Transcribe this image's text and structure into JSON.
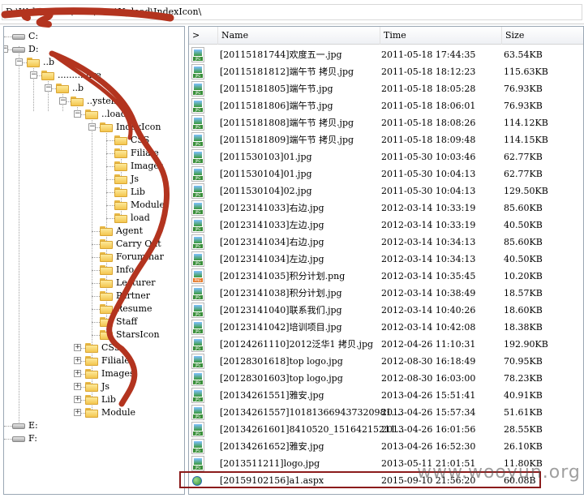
{
  "path_bar": {
    "value": "D:\\Web\\..........\\Web\\.......\\Upload\\IndexIcon\\"
  },
  "tree": {
    "nodes": [
      {
        "label": "C:",
        "kind": "drive"
      },
      {
        "label": "D:",
        "kind": "drive"
      },
      {
        "label": "..b",
        "kind": "folder"
      },
      {
        "label": "..........ure",
        "kind": "folder"
      },
      {
        "label": "..b",
        "kind": "folder"
      },
      {
        "label": "..ystem",
        "kind": "folder"
      },
      {
        "label": "..load",
        "kind": "folder"
      },
      {
        "label": "IndexIcon",
        "kind": "folder"
      },
      {
        "label": "CSS",
        "kind": "folder"
      },
      {
        "label": "Filiale",
        "kind": "folder"
      },
      {
        "label": "Images",
        "kind": "folder"
      },
      {
        "label": "Js",
        "kind": "folder"
      },
      {
        "label": "Lib",
        "kind": "folder"
      },
      {
        "label": "Module",
        "kind": "folder"
      },
      {
        "label": "load",
        "kind": "folder"
      },
      {
        "label": "Agent",
        "kind": "folder"
      },
      {
        "label": "Carry Out",
        "kind": "folder"
      },
      {
        "label": "Foruminar",
        "kind": "folder"
      },
      {
        "label": "Info",
        "kind": "folder"
      },
      {
        "label": "Lecturer",
        "kind": "folder"
      },
      {
        "label": "Partner",
        "kind": "folder"
      },
      {
        "label": "Resume",
        "kind": "folder"
      },
      {
        "label": "Staff",
        "kind": "folder"
      },
      {
        "label": "StarsIcon",
        "kind": "folder"
      },
      {
        "label": "CSS",
        "kind": "folder"
      },
      {
        "label": "Filiale",
        "kind": "folder"
      },
      {
        "label": "Images",
        "kind": "folder"
      },
      {
        "label": "Js",
        "kind": "folder"
      },
      {
        "label": "Lib",
        "kind": "folder"
      },
      {
        "label": "Module",
        "kind": "folder"
      },
      {
        "label": "E:",
        "kind": "drive"
      },
      {
        "label": "F:",
        "kind": "drive"
      }
    ]
  },
  "file_list": {
    "headers": {
      "toggle": ">",
      "name": "Name",
      "time": "Time",
      "size": "Size"
    },
    "rows": [
      {
        "name": "[20115181744]欢度五一.jpg",
        "time": "2011-05-18 17:44:35",
        "size": "63.54KB",
        "type": "jpg"
      },
      {
        "name": "[20115181812]端午节 拷贝.jpg",
        "time": "2011-05-18 18:12:23",
        "size": "115.63KB",
        "type": "jpg"
      },
      {
        "name": "[20115181805]端午节.jpg",
        "time": "2011-05-18 18:05:28",
        "size": "76.93KB",
        "type": "jpg"
      },
      {
        "name": "[20115181806]端午节.jpg",
        "time": "2011-05-18 18:06:01",
        "size": "76.93KB",
        "type": "jpg"
      },
      {
        "name": "[20115181808]端午节 拷贝.jpg",
        "time": "2011-05-18 18:08:26",
        "size": "114.12KB",
        "type": "jpg"
      },
      {
        "name": "[20115181809]端午节 拷贝.jpg",
        "time": "2011-05-18 18:09:48",
        "size": "114.15KB",
        "type": "jpg"
      },
      {
        "name": "[2011530103]01.jpg",
        "time": "2011-05-30 10:03:46",
        "size": "62.77KB",
        "type": "jpg"
      },
      {
        "name": "[2011530104]01.jpg",
        "time": "2011-05-30 10:04:13",
        "size": "62.77KB",
        "type": "jpg"
      },
      {
        "name": "[2011530104]02.jpg",
        "time": "2011-05-30 10:04:13",
        "size": "129.50KB",
        "type": "jpg"
      },
      {
        "name": "[20123141033]右边.jpg",
        "time": "2012-03-14 10:33:19",
        "size": "85.60KB",
        "type": "jpg"
      },
      {
        "name": "[20123141033]左边.jpg",
        "time": "2012-03-14 10:33:19",
        "size": "40.50KB",
        "type": "jpg"
      },
      {
        "name": "[20123141034]右边.jpg",
        "time": "2012-03-14 10:34:13",
        "size": "85.60KB",
        "type": "jpg"
      },
      {
        "name": "[20123141034]左边.jpg",
        "time": "2012-03-14 10:34:13",
        "size": "40.50KB",
        "type": "jpg"
      },
      {
        "name": "[20123141035]积分计划.png",
        "time": "2012-03-14 10:35:45",
        "size": "10.20KB",
        "type": "png"
      },
      {
        "name": "[20123141038]积分计划.jpg",
        "time": "2012-03-14 10:38:49",
        "size": "18.57KB",
        "type": "jpg"
      },
      {
        "name": "[20123141040]联系我们.jpg",
        "time": "2012-03-14 10:40:26",
        "size": "18.60KB",
        "type": "jpg"
      },
      {
        "name": "[20123141042]培训项目.jpg",
        "time": "2012-03-14 10:42:08",
        "size": "18.38KB",
        "type": "jpg"
      },
      {
        "name": "[20124261110]2012泛华1 拷贝.jpg",
        "time": "2012-04-26 11:10:31",
        "size": "192.90KB",
        "type": "jpg"
      },
      {
        "name": "[20128301618]top logo.jpg",
        "time": "2012-08-30 16:18:49",
        "size": "70.95KB",
        "type": "jpg"
      },
      {
        "name": "[20128301603]top logo.jpg",
        "time": "2012-08-30 16:03:00",
        "size": "78.23KB",
        "type": "jpg"
      },
      {
        "name": "[20134261551]雅安.jpg",
        "time": "2013-04-26 15:51:41",
        "size": "40.91KB",
        "type": "jpg"
      },
      {
        "name": "[20134261557]101813669437320981....",
        "time": "2013-04-26 15:57:34",
        "size": "51.61KB",
        "type": "jpg"
      },
      {
        "name": "[20134261601]8410520_15164215211...",
        "time": "2013-04-26 16:01:56",
        "size": "28.55KB",
        "type": "jpg"
      },
      {
        "name": "[20134261652]雅安.jpg",
        "time": "2013-04-26 16:52:30",
        "size": "26.10KB",
        "type": "jpg"
      },
      {
        "name": "[2013511211]logo.jpg",
        "time": "2013-05-11 21:01:51",
        "size": "11.80KB",
        "type": "jpg"
      },
      {
        "name": "[20159102156]a1.aspx",
        "time": "2015-09-10 21:56:20",
        "size": "60.08B",
        "type": "aspx"
      }
    ]
  },
  "watermark": "www.wooyun.org",
  "colors": {
    "highlight": "#8b1b1b",
    "scribble": "#b3341f"
  }
}
